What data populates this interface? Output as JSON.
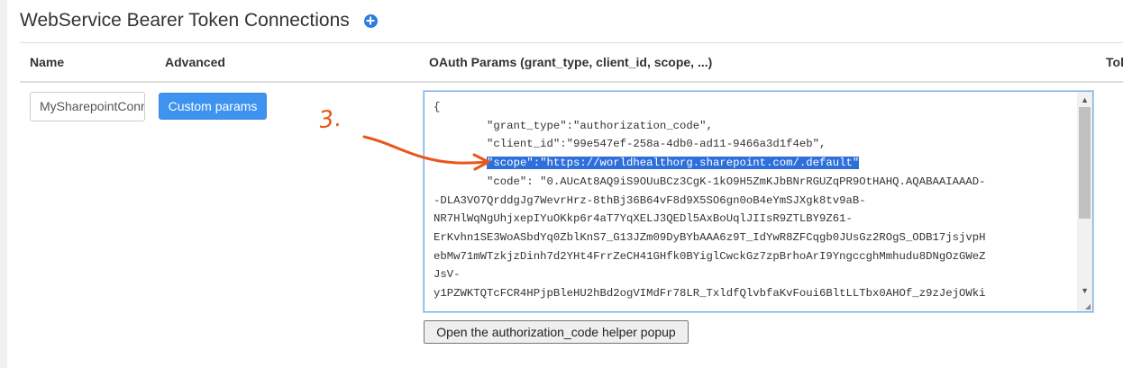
{
  "header": {
    "title": "WebService Bearer Token Connections",
    "add_icon": "plus-circle-icon"
  },
  "table": {
    "columns": [
      "Name",
      "Advanced",
      "OAuth Params (grant_type, client_id, scope, ...)",
      "Tok"
    ],
    "row": {
      "name_value": "MySharepointConnection",
      "custom_params_label": "Custom params",
      "oauth_lines": [
        "{",
        "        \"grant_type\":\"authorization_code\",",
        "        \"client_id\":\"99e547ef-258a-4db0-ad11-9466a3d1f4eb\",",
        "",
        "        \"code\": \"0.AUcAt8AQ9iS9OUuBCz3CgK-1kO9H5ZmKJbBNrRGUZqPR9OtHAHQ.AQABAAIAAAD-",
        "-DLA3VO7QrddgJg7WevrHrz-8thBj36B64vF8d9X5SO6gn0oB4eYmSJXgk8tv9aB-",
        "NR7HlWqNgUhjxepIYuOKkp6r4aT7YqXELJ3QEDl5AxBoUqlJIIsR9ZTLBY9Z61-",
        "ErKvhn1SE3WoASbdYq0ZblKnS7_G13JZm09DyBYbAAA6z9T_IdYwR8ZFCqgb0JUsGz2ROgS_ODB17jsjvpH",
        "ebMw71mWTzkjzDinh7d2YHt4FrrZeCH41GHfk0BYiglCwckGz7zpBrhoArI9YngccghMmhudu8DNgOzGWeZ",
        "JsV-",
        "y1PZWKTQTcFCR4HPjpBleHU2hBd2ogVIMdFr78LR_TxldfQlvbfaKvFoui6BltLLTbx0AHOf_z9zJejOWki"
      ],
      "highlight_indent": "        ",
      "highlight_text": "\"scope\":\"https://worldhealthorg.sharepoint.com/.default\"",
      "helper_button_label": "Open the authorization_code helper popup"
    }
  },
  "annotation": {
    "label": "3.",
    "color": "#e8561a"
  },
  "colors": {
    "primary": "#3e93f0",
    "selection": "#2f6fdb",
    "annotation": "#e8561a"
  }
}
